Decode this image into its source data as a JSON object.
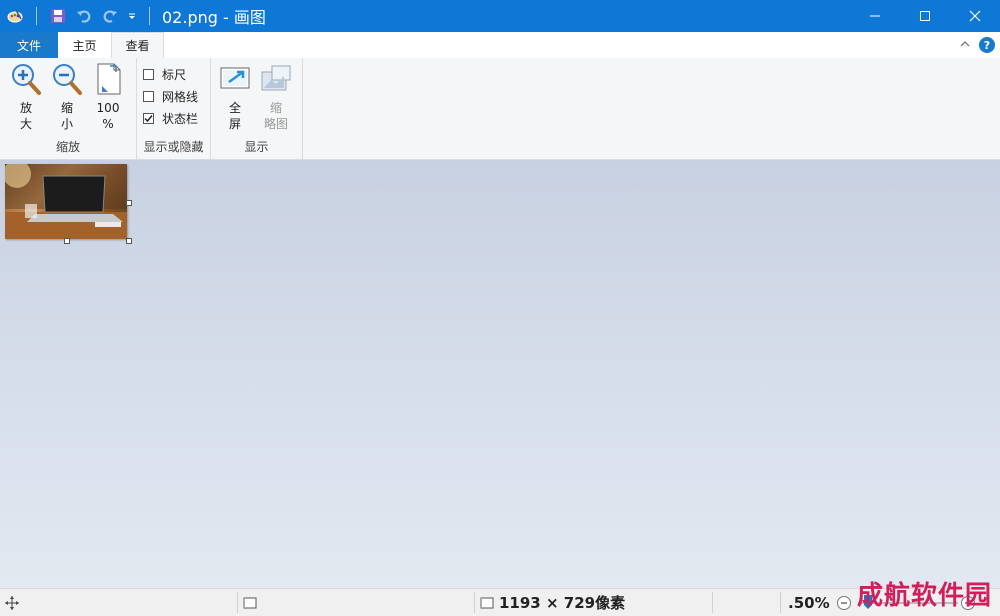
{
  "window": {
    "title": "02.png - 画图"
  },
  "tabs": {
    "file": "文件",
    "home": "主页",
    "view": "查看"
  },
  "help_label": "?",
  "ribbon": {
    "zoom_group": {
      "label": "缩放",
      "zoom_in": "放\n大",
      "zoom_out": "缩\n小",
      "actual_size": "100\n%"
    },
    "show_hide_group": {
      "label": "显示或隐藏",
      "ruler": "标尺",
      "ruler_checked": false,
      "gridlines": "网格线",
      "gridlines_checked": false,
      "statusbar": "状态栏",
      "statusbar_checked": true
    },
    "display_group": {
      "label": "显示",
      "fullscreen": "全\n屏",
      "thumbnail": "缩\n略图"
    }
  },
  "status": {
    "image_size": "1193 × 729像素",
    "zoom": ".50%"
  },
  "watermark": "成航软件园",
  "colors": {
    "titlebar": "#0f78d7",
    "file_tab": "#1979ca",
    "ribbon_bg": "#f5f6f7",
    "watermark": "#d01f5a"
  }
}
